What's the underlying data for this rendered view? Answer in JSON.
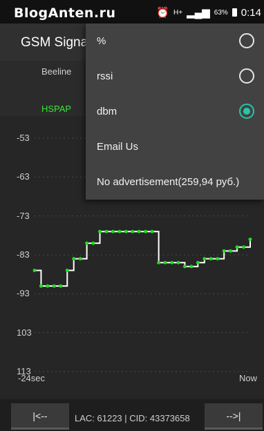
{
  "statusbar": {
    "watermark": "BlogAnten.ru",
    "network_type": "H+",
    "battery": "63%",
    "time": "0:14"
  },
  "app": {
    "title": "GSM Signal"
  },
  "info": {
    "operator": "Beeline",
    "network": "HSPAP"
  },
  "chart_data": {
    "type": "line",
    "title": "",
    "xlabel": "",
    "ylabel": "",
    "x_start_label": "-24sec",
    "x_end_label": "Now",
    "ylim": [
      -113,
      -53
    ],
    "yticks": [
      "-53",
      "-63",
      "-73",
      "-83",
      "-93",
      "103",
      "113"
    ],
    "grid": true,
    "series": [
      {
        "values": [
          -87,
          -91,
          -91,
          -91,
          -91,
          -87,
          -84,
          -84,
          -80,
          -80,
          -77,
          -77,
          -77,
          -77,
          -77,
          -77,
          -77,
          -77,
          -77,
          -85,
          -85,
          -85,
          -85,
          -86,
          -86,
          -85,
          -84,
          -84,
          -84,
          -82,
          -82,
          -81,
          -81,
          -79
        ]
      }
    ]
  },
  "bottom": {
    "prev_label": "|<--",
    "info": "LAC: 61223 | CID: 43373658",
    "next_label": "-->|"
  },
  "menu": {
    "items": [
      {
        "label": "%",
        "radio": true,
        "checked": false
      },
      {
        "label": "rssi",
        "radio": true,
        "checked": false
      },
      {
        "label": "dbm",
        "radio": true,
        "checked": true
      },
      {
        "label": "Email Us",
        "radio": false
      },
      {
        "label": "No advertisement(259,94 руб.)",
        "radio": false
      }
    ]
  },
  "colors": {
    "accent": "#26c6a8",
    "network": "#39e639",
    "points": "#22dd22"
  }
}
